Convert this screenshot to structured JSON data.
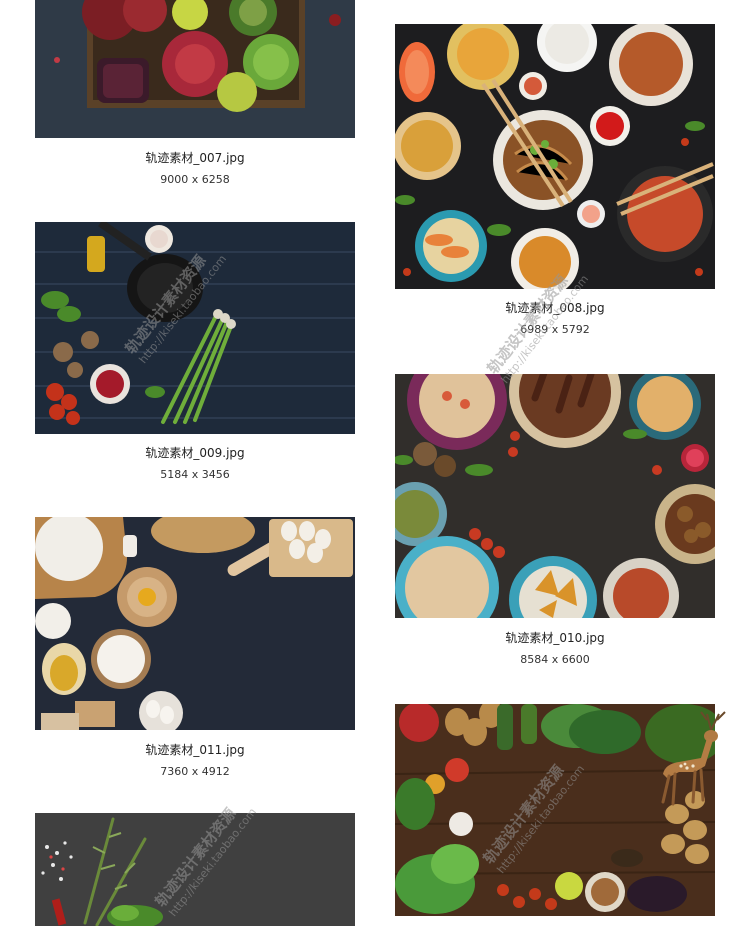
{
  "gallery": {
    "items": [
      {
        "id": "007",
        "caption": "轨迹素材_007.jpg",
        "dims": "9000 x 6258",
        "theme": "pomegranate-lime-tray"
      },
      {
        "id": "008",
        "caption": "轨迹素材_008.jpg",
        "dims": "6989 x 5792",
        "theme": "asian-food-spread"
      },
      {
        "id": "009",
        "caption": "轨迹素材_009.jpg",
        "dims": "5184 x 3456",
        "theme": "pan-vegetables-wood"
      },
      {
        "id": "010",
        "caption": "轨迹素材_010.jpg",
        "dims": "8584 x 6600",
        "theme": "middle-eastern-plates"
      },
      {
        "id": "011",
        "caption": "轨迹素材_011.jpg",
        "dims": "7360 x 4912",
        "theme": "baking-flour-eggs"
      },
      {
        "id": "012",
        "caption": "",
        "dims": "",
        "theme": "rosemary-salt-slate"
      },
      {
        "id": "013",
        "caption": "",
        "dims": "",
        "theme": "vegetable-frame-deer"
      }
    ]
  },
  "watermark": {
    "line1": "轨迹设计素材资源",
    "line2": "http://kiseki.taobao.com"
  }
}
